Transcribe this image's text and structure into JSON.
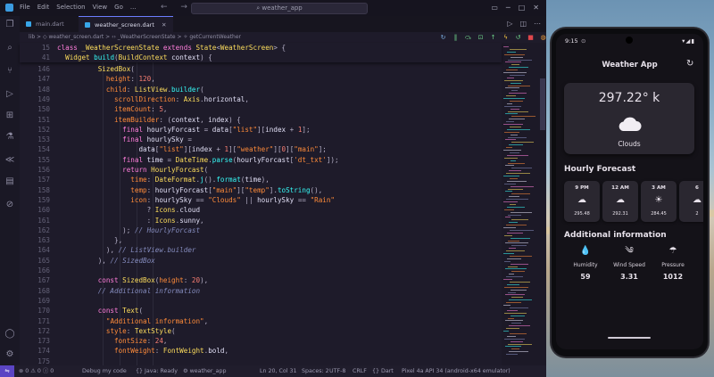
{
  "titlebar": {
    "menus": [
      "File",
      "Edit",
      "Selection",
      "View",
      "Go",
      "..."
    ],
    "search": "weather_app",
    "nav_glyphs": "← →"
  },
  "tabs": [
    {
      "label": "main.dart",
      "active": false
    },
    {
      "label": "weather_screen.dart",
      "active": true
    }
  ],
  "breadcrumb": "lib > ◇ weather_screen.dart > ‹› _WeatherScreenState > ✧ getCurrentWeather",
  "sticky_lines": [
    {
      "n": "15",
      "html": "<span class='kw'>class</span> <span class='cl'>_WeatherScreenState</span> <span class='kw'>extends</span> <span class='cl'>State</span><span class='pu'>&lt;</span><span class='cl'>WeatherScreen</span><span class='pu'>&gt;</span> <span class='pu'>{</span>"
    },
    {
      "n": "41",
      "html": "  <span class='cl'>Widget</span> <span class='fn'>build</span><span class='pu'>(</span><span class='cl'>BuildContext</span> <span class='id'>context</span><span class='pu'>)</span> <span class='pu'>{</span>"
    }
  ],
  "code_lines": [
    {
      "n": "146",
      "html": "          <span class='cl'>SizedBox</span><span class='pu'>(</span>"
    },
    {
      "n": "147",
      "html": "            <span class='pr'>height</span><span class='pu'>:</span> <span class='nu'>120</span><span class='pu'>,</span>"
    },
    {
      "n": "148",
      "html": "            <span class='pr'>child</span><span class='pu'>:</span> <span class='cl'>ListView</span><span class='pu'>.</span><span class='fn'>builder</span><span class='pu'>(</span>"
    },
    {
      "n": "149",
      "html": "              <span class='pr'>scrollDirection</span><span class='pu'>:</span> <span class='cl'>Axis</span><span class='pu'>.</span><span class='id'>horizontal</span><span class='pu'>,</span>"
    },
    {
      "n": "150",
      "html": "              <span class='pr'>itemCount</span><span class='pu'>:</span> <span class='nu'>5</span><span class='pu'>,</span>"
    },
    {
      "n": "151",
      "html": "              <span class='pr'>itemBuilder</span><span class='pu'>:</span> <span class='pu'>(</span><span class='id'>context</span><span class='pu'>,</span> <span class='id'>index</span><span class='pu'>)</span> <span class='pu'>{</span>"
    },
    {
      "n": "152",
      "html": "                <span class='kw'>final</span> <span class='id'>hourlyForcast</span> <span class='pu'>=</span> <span class='id'>data</span><span class='pu'>[</span><span class='st'>\"list\"</span><span class='pu'>][</span><span class='id'>index</span> <span class='pu'>+</span> <span class='nu'>1</span><span class='pu'>];</span>"
    },
    {
      "n": "153",
      "html": "                <span class='kw'>final</span> <span class='id'>hourlySky</span> <span class='pu'>=</span>"
    },
    {
      "n": "154",
      "html": "                    <span class='id'>data</span><span class='pu'>[</span><span class='st'>\"list\"</span><span class='pu'>][</span><span class='id'>index</span> <span class='pu'>+</span> <span class='nu'>1</span><span class='pu'>][</span><span class='st'>\"weather\"</span><span class='pu'>][</span><span class='nu'>0</span><span class='pu'>][</span><span class='st'>\"main\"</span><span class='pu'>];</span>"
    },
    {
      "n": "155",
      "html": "                <span class='kw'>final</span> <span class='id'>time</span> <span class='pu'>=</span> <span class='cl'>DateTime</span><span class='pu'>.</span><span class='fn'>parse</span><span class='pu'>(</span><span class='id'>hourlyForcast</span><span class='pu'>[</span><span class='st'>'dt_txt'</span><span class='pu'>]);</span>"
    },
    {
      "n": "156",
      "html": "                <span class='kw'>return</span> <span class='cl'>HourlyForcast</span><span class='pu'>(</span>"
    },
    {
      "n": "157",
      "html": "                  <span class='pr'>time</span><span class='pu'>:</span> <span class='cl'>DateFormat</span><span class='pu'>.</span><span class='fn'>j</span><span class='pu'>().</span><span class='fn'>format</span><span class='pu'>(</span><span class='id'>time</span><span class='pu'>),</span>"
    },
    {
      "n": "158",
      "html": "                  <span class='pr'>temp</span><span class='pu'>:</span> <span class='id'>hourlyForcast</span><span class='pu'>[</span><span class='st'>\"main\"</span><span class='pu'>][</span><span class='st'>\"temp\"</span><span class='pu'>].</span><span class='fn'>toString</span><span class='pu'>(),</span>"
    },
    {
      "n": "159",
      "html": "                  <span class='pr'>icon</span><span class='pu'>:</span> <span class='id'>hourlySky</span> <span class='pu'>==</span> <span class='st'>\"Clouds\"</span> <span class='pu'>||</span> <span class='id'>hourlySky</span> <span class='pu'>==</span> <span class='st'>\"Rain\"</span>"
    },
    {
      "n": "160",
      "html": "                      <span class='pu'>?</span> <span class='cl'>Icons</span><span class='pu'>.</span><span class='id'>cloud</span>"
    },
    {
      "n": "161",
      "html": "                      <span class='pu'>:</span> <span class='cl'>Icons</span><span class='pu'>.</span><span class='id'>sunny</span><span class='pu'>,</span>"
    },
    {
      "n": "162",
      "html": "                <span class='pu'>);</span> <span class='cm'>// HourlyForcast</span>"
    },
    {
      "n": "163",
      "html": "              <span class='pu'>},</span>"
    },
    {
      "n": "164",
      "html": "            <span class='pu'>),</span> <span class='cm'>// ListView.builder</span>"
    },
    {
      "n": "165",
      "html": "          <span class='pu'>),</span> <span class='cm'>// SizedBox</span>"
    },
    {
      "n": "166",
      "html": ""
    },
    {
      "n": "167",
      "html": "          <span class='kw'>const</span> <span class='cl'>SizedBox</span><span class='pu'>(</span><span class='pr'>height</span><span class='pu'>:</span> <span class='nu'>20</span><span class='pu'>),</span>"
    },
    {
      "n": "168",
      "html": "          <span class='cm'>// Additional information</span>"
    },
    {
      "n": "169",
      "html": ""
    },
    {
      "n": "170",
      "html": "          <span class='kw'>const</span> <span class='cl'>Text</span><span class='pu'>(</span>"
    },
    {
      "n": "171",
      "html": "            <span class='st'>\"Additional information\"</span><span class='pu'>,</span>"
    },
    {
      "n": "172",
      "html": "            <span class='pr'>style</span><span class='pu'>:</span> <span class='cl'>TextStyle</span><span class='pu'>(</span>"
    },
    {
      "n": "173",
      "html": "              <span class='pr'>fontSize</span><span class='pu'>:</span> <span class='nu'>24</span><span class='pu'>,</span>"
    },
    {
      "n": "174",
      "html": "              <span class='pr'>fontWeight</span><span class='pu'>:</span> <span class='cl'>FontWeight</span><span class='pu'>.</span><span class='id'>bold</span><span class='pu'>,</span>"
    },
    {
      "n": "175",
      "html": ""
    }
  ],
  "statusbar": {
    "problems": "⊗ 0 ⚠ 0  ⓘ 0",
    "debug": "Debug my code",
    "java": "{} Java: Ready",
    "app": "⚙ weather_app",
    "position": "Ln 20, Col 31",
    "spaces": "Spaces: 2",
    "encoding": "UTF-8",
    "eol": "CRLF",
    "language": "{} Dart",
    "device": "Pixel 4a API 34 (android-x64 emulator)"
  },
  "phone": {
    "status_time": "9:15",
    "app_title": "Weather App",
    "current": {
      "temp": "297.22° k",
      "sky": "Clouds"
    },
    "hourly_title": "Hourly Forecast",
    "hourly": [
      {
        "time": "9 PM",
        "icon": "cloud-icon",
        "temp": "295.48"
      },
      {
        "time": "12 AM",
        "icon": "cloud-icon",
        "temp": "292.31"
      },
      {
        "time": "3 AM",
        "icon": "sun-icon",
        "temp": "284.45"
      },
      {
        "time": "6",
        "icon": "cloud-icon",
        "temp": "2"
      }
    ],
    "additional_title": "Additional information",
    "info": [
      {
        "label": "Humidity",
        "value": "59",
        "icon": "water-drop-icon"
      },
      {
        "label": "Wind Speed",
        "value": "3.31",
        "icon": "wind-icon"
      },
      {
        "label": "Pressure",
        "value": "1012",
        "icon": "pressure-icon"
      }
    ]
  }
}
